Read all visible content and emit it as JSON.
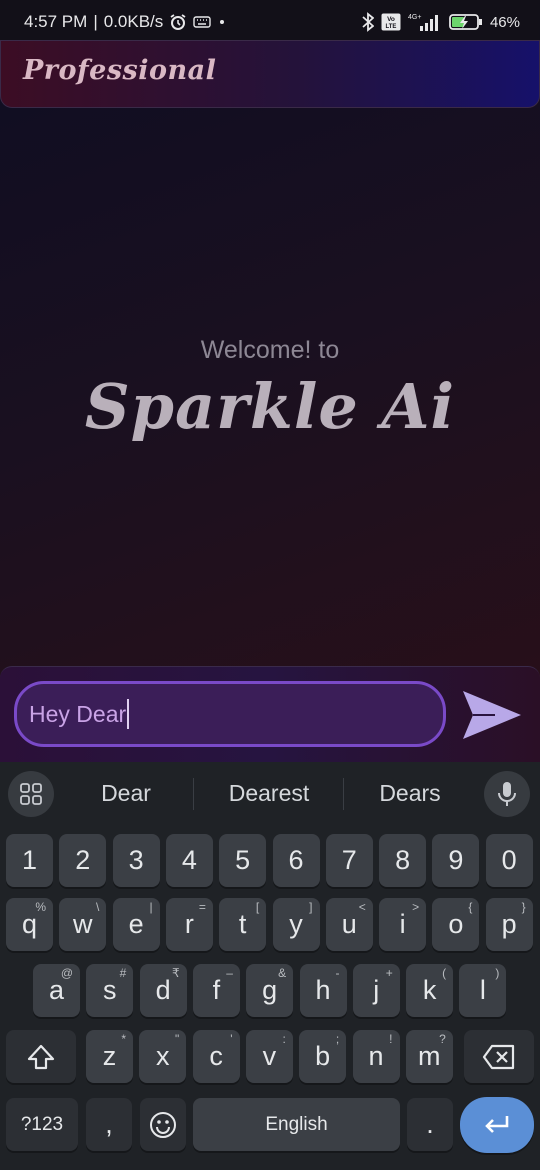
{
  "status_bar": {
    "time": "4:57 PM",
    "separator": "|",
    "net_speed": "0.0KB/s",
    "volte": "Vo LTE",
    "network": "4G+",
    "battery": "46%",
    "icons": [
      "alarm-icon",
      "keyboard-icon",
      "dot-icon",
      "bluetooth-icon",
      "volte-icon",
      "signal-icon",
      "battery-charging-icon"
    ]
  },
  "app": {
    "mode_title": "Professional",
    "welcome": "Welcome! to",
    "brand": "Sparkle Ai",
    "input_value": "Hey Dear",
    "send_icon": "send-icon",
    "colors": {
      "accent": "#7a4ac8",
      "input_bg": "#3b1e58",
      "send": "#b8a8e8"
    }
  },
  "keyboard": {
    "suggestions": [
      "Dear",
      "Dearest",
      "Dears"
    ],
    "row_numbers": [
      "1",
      "2",
      "3",
      "4",
      "5",
      "6",
      "7",
      "8",
      "9",
      "0"
    ],
    "row1": [
      {
        "k": "q",
        "h": "%"
      },
      {
        "k": "w",
        "h": "\\"
      },
      {
        "k": "e",
        "h": "|"
      },
      {
        "k": "r",
        "h": "="
      },
      {
        "k": "t",
        "h": "["
      },
      {
        "k": "y",
        "h": "]"
      },
      {
        "k": "u",
        "h": "<"
      },
      {
        "k": "i",
        "h": ">"
      },
      {
        "k": "o",
        "h": "{"
      },
      {
        "k": "p",
        "h": "}"
      }
    ],
    "row2": [
      {
        "k": "a",
        "h": "@"
      },
      {
        "k": "s",
        "h": "#"
      },
      {
        "k": "d",
        "h": "₹"
      },
      {
        "k": "f",
        "h": "–"
      },
      {
        "k": "g",
        "h": "&"
      },
      {
        "k": "h",
        "h": "-"
      },
      {
        "k": "j",
        "h": "+"
      },
      {
        "k": "k",
        "h": "("
      },
      {
        "k": "l",
        "h": ")"
      }
    ],
    "row3": [
      {
        "k": "z",
        "h": "*"
      },
      {
        "k": "x",
        "h": "\""
      },
      {
        "k": "c",
        "h": "'"
      },
      {
        "k": "v",
        "h": ":"
      },
      {
        "k": "b",
        "h": ";"
      },
      {
        "k": "n",
        "h": "!"
      },
      {
        "k": "m",
        "h": "?"
      }
    ],
    "symbols_label": "?123",
    "comma": ",",
    "space_label": "English",
    "period": ".",
    "accent_color": "#5b8fd6"
  }
}
